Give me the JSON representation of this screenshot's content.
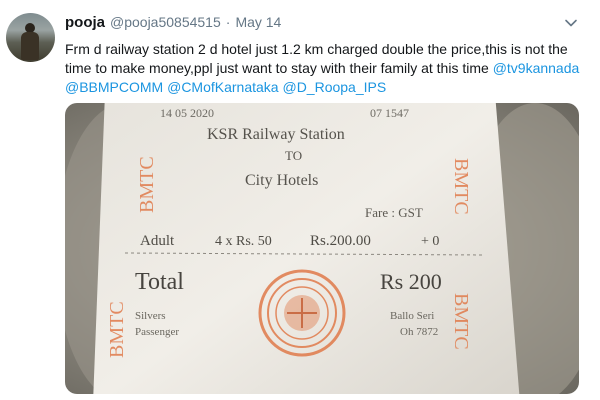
{
  "tweet": {
    "display_name": "pooja",
    "handle": "@pooja50854515",
    "separator": "·",
    "date": "May 14",
    "text_body": "Frm d railway station 2 d hotel just 1.2 km charged double the price,this is not the time to make money,ppl just want to stay with their family at this time ",
    "mentions": [
      "@tv9kannada",
      "@BBMPCOMM",
      "@CMofKarnataka",
      "@D_Roopa_IPS"
    ]
  },
  "ticket": {
    "date_line": "14 05 2020",
    "code": "07 1547",
    "from": "KSR Railway Station",
    "to_label": "TO",
    "to": "City Hotels",
    "fare_line": "Fare : GST",
    "adult_label": "Adult",
    "adult_calc": "4 x Rs. 50",
    "adult_amount": "Rs.200.00",
    "adult_tail": "+ 0",
    "total_label": "Total",
    "total_value": "Rs 200",
    "brand": "BMTC",
    "footer_left_1": "Silvers",
    "footer_left_2": "Passenger",
    "footer_right_1": "Ballo Seri",
    "footer_right_2": "Oh 7872"
  },
  "icons": {
    "caret": "chevron-down-icon"
  },
  "colors": {
    "link": "#1b95e0",
    "secondary": "#657786",
    "stamp": "#e07a4a"
  }
}
